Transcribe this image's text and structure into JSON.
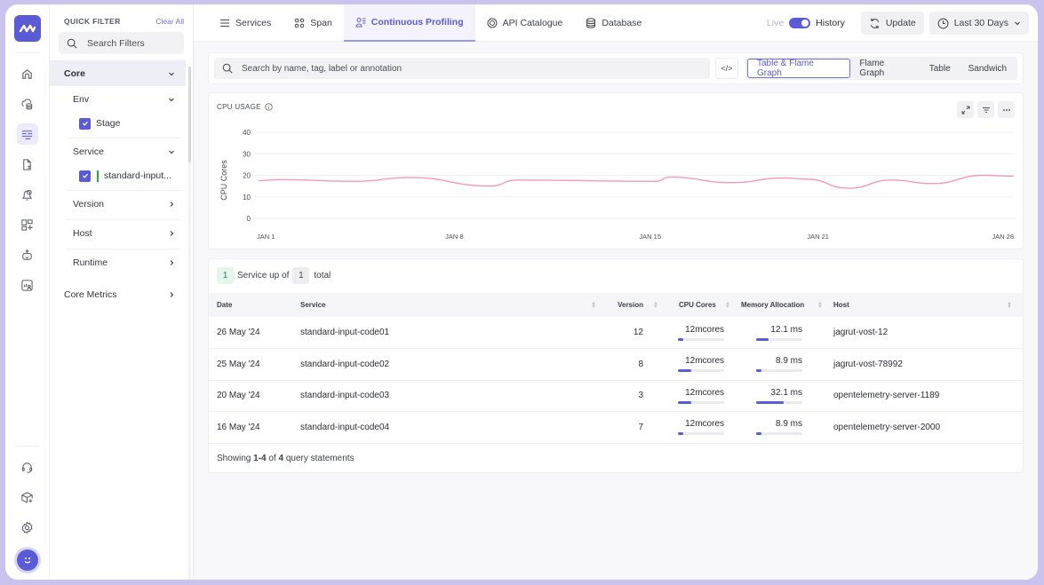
{
  "quick_filter": {
    "title": "QUICK FILTER",
    "clear_all": "Clear All",
    "search_placeholder": "Search Filters",
    "groups": {
      "core": "Core",
      "env": "Env",
      "env_value": "Stage",
      "service": "Service",
      "service_value": "standard-input...",
      "version": "Version",
      "host": "Host",
      "runtime": "Runtime",
      "core_metrics": "Core Metrics"
    }
  },
  "tabs": [
    {
      "label": "Services",
      "icon": "list-icon"
    },
    {
      "label": "Span",
      "icon": "span-icon"
    },
    {
      "label": "Continuous Profiling",
      "icon": "profiling-icon",
      "active": true
    },
    {
      "label": "API Catalogue",
      "icon": "api-icon"
    },
    {
      "label": "Database",
      "icon": "database-icon"
    }
  ],
  "top_right": {
    "live_label": "Live",
    "history_label": "History",
    "history_enabled": true,
    "update_label": "Update",
    "time_range": "Last 30 Days"
  },
  "toolbar": {
    "search_placeholder": "Search by name, tag, label or annotation",
    "code_label": "</>",
    "views": [
      "Table & Flame Graph",
      "Flame Graph",
      "Table",
      "Sandwich"
    ],
    "active_view": "Table & Flame Graph"
  },
  "chart_data": {
    "type": "line",
    "title": "CPU USAGE",
    "xlabel": "",
    "ylabel": "CPU Cores",
    "ylim": [
      0,
      40
    ],
    "yticks": [
      0,
      10,
      20,
      30,
      40
    ],
    "xlim": [
      1,
      28
    ],
    "xticks": [
      {
        "day": 1,
        "label": "JAN 1"
      },
      {
        "day": 8,
        "label": "JAN 8"
      },
      {
        "day": 15,
        "label": "JAN 15"
      },
      {
        "day": 21,
        "label": "JAN 21"
      },
      {
        "day": 28,
        "label": "JAN 28"
      }
    ],
    "grid": true,
    "color": "#f29bb5",
    "series": [
      {
        "name": "CPU Cores",
        "x": [
          1,
          1.7,
          4.5,
          6.4,
          9.3,
          10.2,
          15.2,
          15.7,
          17.9,
          19.8,
          20.6,
          22.1,
          23.6,
          25.1,
          26.9,
          28
        ],
        "values": [
          17.5,
          18,
          17.2,
          19,
          15,
          17.8,
          17.2,
          19.2,
          16.6,
          18.8,
          18.2,
          14,
          17.8,
          16.2,
          20,
          19.6
        ]
      }
    ]
  },
  "summary": {
    "up_count": "1",
    "up_text": "Service up of",
    "total_count": "1",
    "total_text": "total"
  },
  "table": {
    "columns": [
      "Date",
      "Service",
      "Version",
      "CPU Cores",
      "Memory Allocation",
      "Host"
    ],
    "rows": [
      {
        "date": "26 May '24",
        "service": "standard-input-code01",
        "version": "12",
        "cpu": "12mcores",
        "cpu_pct": 0.12,
        "mem": "12.1 ms",
        "mem_pct": 0.27,
        "host": "jagrut-vost-12"
      },
      {
        "date": "25 May '24",
        "service": "standard-input-code02",
        "version": "8",
        "cpu": "12mcores",
        "cpu_pct": 0.28,
        "mem": "8.9 ms",
        "mem_pct": 0.12,
        "host": "jagrut-vost-78992"
      },
      {
        "date": "20 May '24",
        "service": "standard-input-code03",
        "version": "3",
        "cpu": "12mcores",
        "cpu_pct": 0.28,
        "mem": "32.1 ms",
        "mem_pct": 0.6,
        "host": "opentelemetry-server-1189"
      },
      {
        "date": "16 May '24",
        "service": "standard-input-code04",
        "version": "7",
        "cpu": "12mcores",
        "cpu_pct": 0.12,
        "mem": "8.9 ms",
        "mem_pct": 0.12,
        "host": "opentelemetry-server-2000"
      }
    ],
    "footer": {
      "prefix": "Showing",
      "range": "1-4",
      "of": "of",
      "total": "4",
      "suffix": "query statements"
    }
  },
  "colors": {
    "accent": "#5b5bd6",
    "chart_line": "#f29bb5",
    "up_green": "#1f8a4a"
  }
}
